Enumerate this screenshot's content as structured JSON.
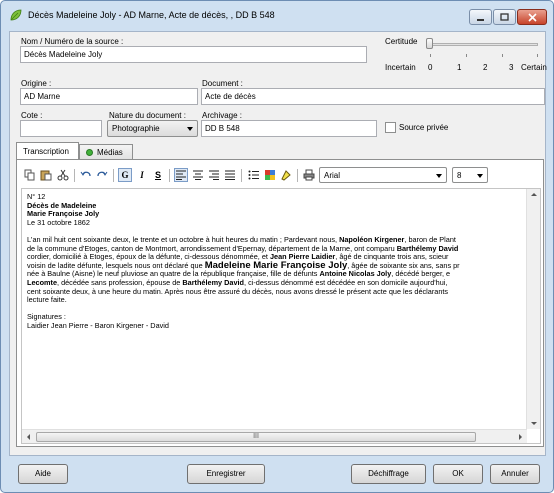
{
  "window": {
    "title": "Décès Madeleine Joly - AD Marne, Acte de décès, , DD B 548"
  },
  "form": {
    "source_label": "Nom / Numéro de la source :",
    "source_value": "Décès Madeleine Joly",
    "certitude_label": "Certitude",
    "certitude_scale": [
      "Incertain",
      "0",
      "1",
      "2",
      "3",
      "Certain"
    ],
    "certitude_value": 0,
    "origine_label": "Origine :",
    "origine_value": "AD Marne",
    "document_label": "Document :",
    "document_value": "Acte de décès",
    "cote_label": "Cote :",
    "cote_value": "",
    "nature_label": "Nature du document :",
    "nature_value": "Photographie",
    "archivage_label": "Archivage :",
    "archivage_value": "DD B 548",
    "source_privee_label": "Source privée",
    "source_privee_checked": false
  },
  "tabs": [
    {
      "label": "Transcription",
      "active": true
    },
    {
      "label": "Médias",
      "active": false
    }
  ],
  "toolbar": {
    "font_name": "Arial",
    "font_size": "8",
    "icons": [
      "copy-icon",
      "paste-icon",
      "cut-icon",
      "undo-icon",
      "redo-icon",
      "bold-icon",
      "italic-icon",
      "underline-icon",
      "align-left-icon",
      "align-center-icon",
      "align-right-icon",
      "justify-icon",
      "bullet-list-icon",
      "text-color-icon",
      "highlight-icon",
      "print-icon"
    ]
  },
  "transcript": {
    "number": "N° 12",
    "heading1": "Décès de Madeleine",
    "heading2": "Marie Françoise Joly",
    "date": "Le 31 octobre 1862",
    "p1": "L'an mil huit cent soixante deux, le trente et un octobre à huit heures du matin ; Pardevant nous, ",
    "p1_b1": "Napoléon Kirgener",
    "p1_r1": ", baron de Plant",
    "p2": "de la commune d'Etoges, canton de Montmort, arrondissement d'Epernay, département de la Marne, ont comparu ",
    "p2_b1": "Barthélemy David",
    "p3": "cordier, domicilié à Etoges, époux de la défunte, ci-dessous dénommée, et ",
    "p3_b1": "Jean Pierre Laidier",
    "p3_r1": ", âgé de cinquante trois ans, scieur",
    "p4": "voisin de ladite défunte, lesquels nous ont déclaré que ",
    "p4_b1": "Madeleine Marie Françoise Joly",
    "p4_r1": ", âgée de soixante six ans, sans pr",
    "p5": "née à Baulne (Aisne) le neuf pluviose an quatre de la république française, fille de défunts ",
    "p5_b1": "Antoine Nicolas Joly",
    "p5_r1": ", décédé berger, e",
    "p6_b1": "Lecomte",
    "p6": ", décédée sans profession, épouse de ",
    "p6_b2": "Barthélemy David",
    "p6_r1": ", ci-dessus dénommé est décédée en son domicile aujourd'hui,",
    "p7": "cent soixante deux, à une heure du matin. Après nous être assuré du décès, nous avons dressé le présent acte que les déclarants",
    "p8": "lecture faite.",
    "signatures_label": "Signatures :",
    "signatures": "Laidier Jean Pierre - Baron Kirgener - David"
  },
  "scrollbar_grip": "III",
  "buttons": {
    "aide": "Aide",
    "enregistrer": "Enregistrer",
    "dechiffrage": "Déchiffrage",
    "ok": "OK",
    "annuler": "Annuler"
  }
}
